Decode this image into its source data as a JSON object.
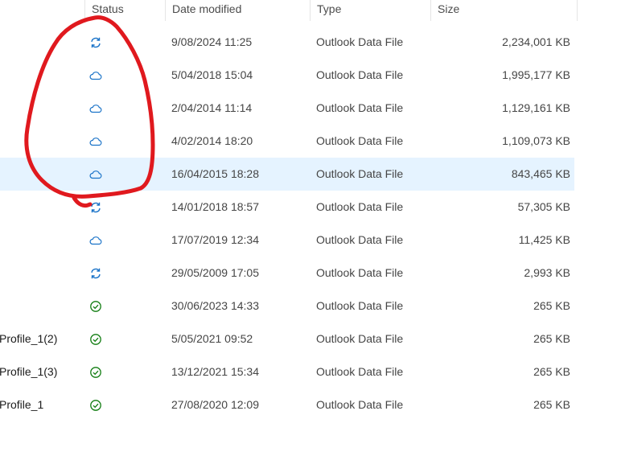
{
  "columns": {
    "status": "Status",
    "date_modified": "Date modified",
    "type": "Type",
    "size": "Size"
  },
  "colors": {
    "cloud_icon": "#1a73c8",
    "sync_icon": "#1a73c8",
    "ok_icon": "#107c10",
    "selected_row": "#e5f3ff",
    "annotation_stroke": "#e0191e"
  },
  "rows": [
    {
      "name": "",
      "status_icon": "sync-icon",
      "date": "9/08/2024 11:25",
      "type": "Outlook Data File",
      "size": "2,234,001 KB",
      "selected": false
    },
    {
      "name": "",
      "status_icon": "cloud-icon",
      "date": "5/04/2018 15:04",
      "type": "Outlook Data File",
      "size": "1,995,177 KB",
      "selected": false
    },
    {
      "name": "",
      "status_icon": "cloud-icon",
      "date": "2/04/2014 11:14",
      "type": "Outlook Data File",
      "size": "1,129,161 KB",
      "selected": false
    },
    {
      "name": "",
      "status_icon": "cloud-icon",
      "date": "4/02/2014 18:20",
      "type": "Outlook Data File",
      "size": "1,109,073 KB",
      "selected": false
    },
    {
      "name": "",
      "status_icon": "cloud-icon",
      "date": "16/04/2015 18:28",
      "type": "Outlook Data File",
      "size": "843,465 KB",
      "selected": true
    },
    {
      "name": "",
      "status_icon": "sync-icon",
      "date": "14/01/2018 18:57",
      "type": "Outlook Data File",
      "size": "57,305 KB",
      "selected": false
    },
    {
      "name": "",
      "status_icon": "cloud-icon",
      "date": "17/07/2019 12:34",
      "type": "Outlook Data File",
      "size": "11,425 KB",
      "selected": false
    },
    {
      "name": "",
      "status_icon": "sync-icon",
      "date": "29/05/2009 17:05",
      "type": "Outlook Data File",
      "size": "2,993 KB",
      "selected": false
    },
    {
      "name": "",
      "status_icon": "check-circle-icon",
      "date": "30/06/2023 14:33",
      "type": "Outlook Data File",
      "size": "265 KB",
      "selected": false
    },
    {
      "name": "Profile_1(2)",
      "status_icon": "check-circle-icon",
      "date": "5/05/2021 09:52",
      "type": "Outlook Data File",
      "size": "265 KB",
      "selected": false
    },
    {
      "name": "Profile_1(3)",
      "status_icon": "check-circle-icon",
      "date": "13/12/2021 15:34",
      "type": "Outlook Data File",
      "size": "265 KB",
      "selected": false
    },
    {
      "name": "Profile_1",
      "status_icon": "check-circle-icon",
      "date": "27/08/2020 12:09",
      "type": "Outlook Data File",
      "size": "265 KB",
      "selected": false
    }
  ]
}
